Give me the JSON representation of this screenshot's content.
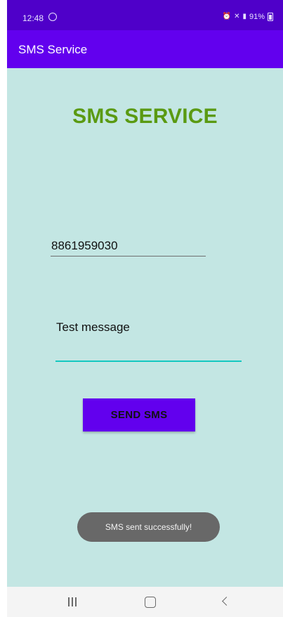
{
  "status_bar": {
    "time": "12:48",
    "battery": "91%"
  },
  "app_bar": {
    "title": "SMS Service"
  },
  "main": {
    "heading": "SMS SERVICE",
    "phone_number": "8861959030",
    "message": "Test message",
    "send_button_label": "SEND SMS"
  },
  "toast": {
    "text": "SMS sent successfully!"
  },
  "colors": {
    "status_bar": "#4f00c9",
    "app_bar": "#6200ee",
    "content_background": "#c3e6e3",
    "heading": "#5a9a12",
    "field_focus_line": "#14c8c0",
    "button": "#6200ee",
    "toast": "#686868"
  }
}
